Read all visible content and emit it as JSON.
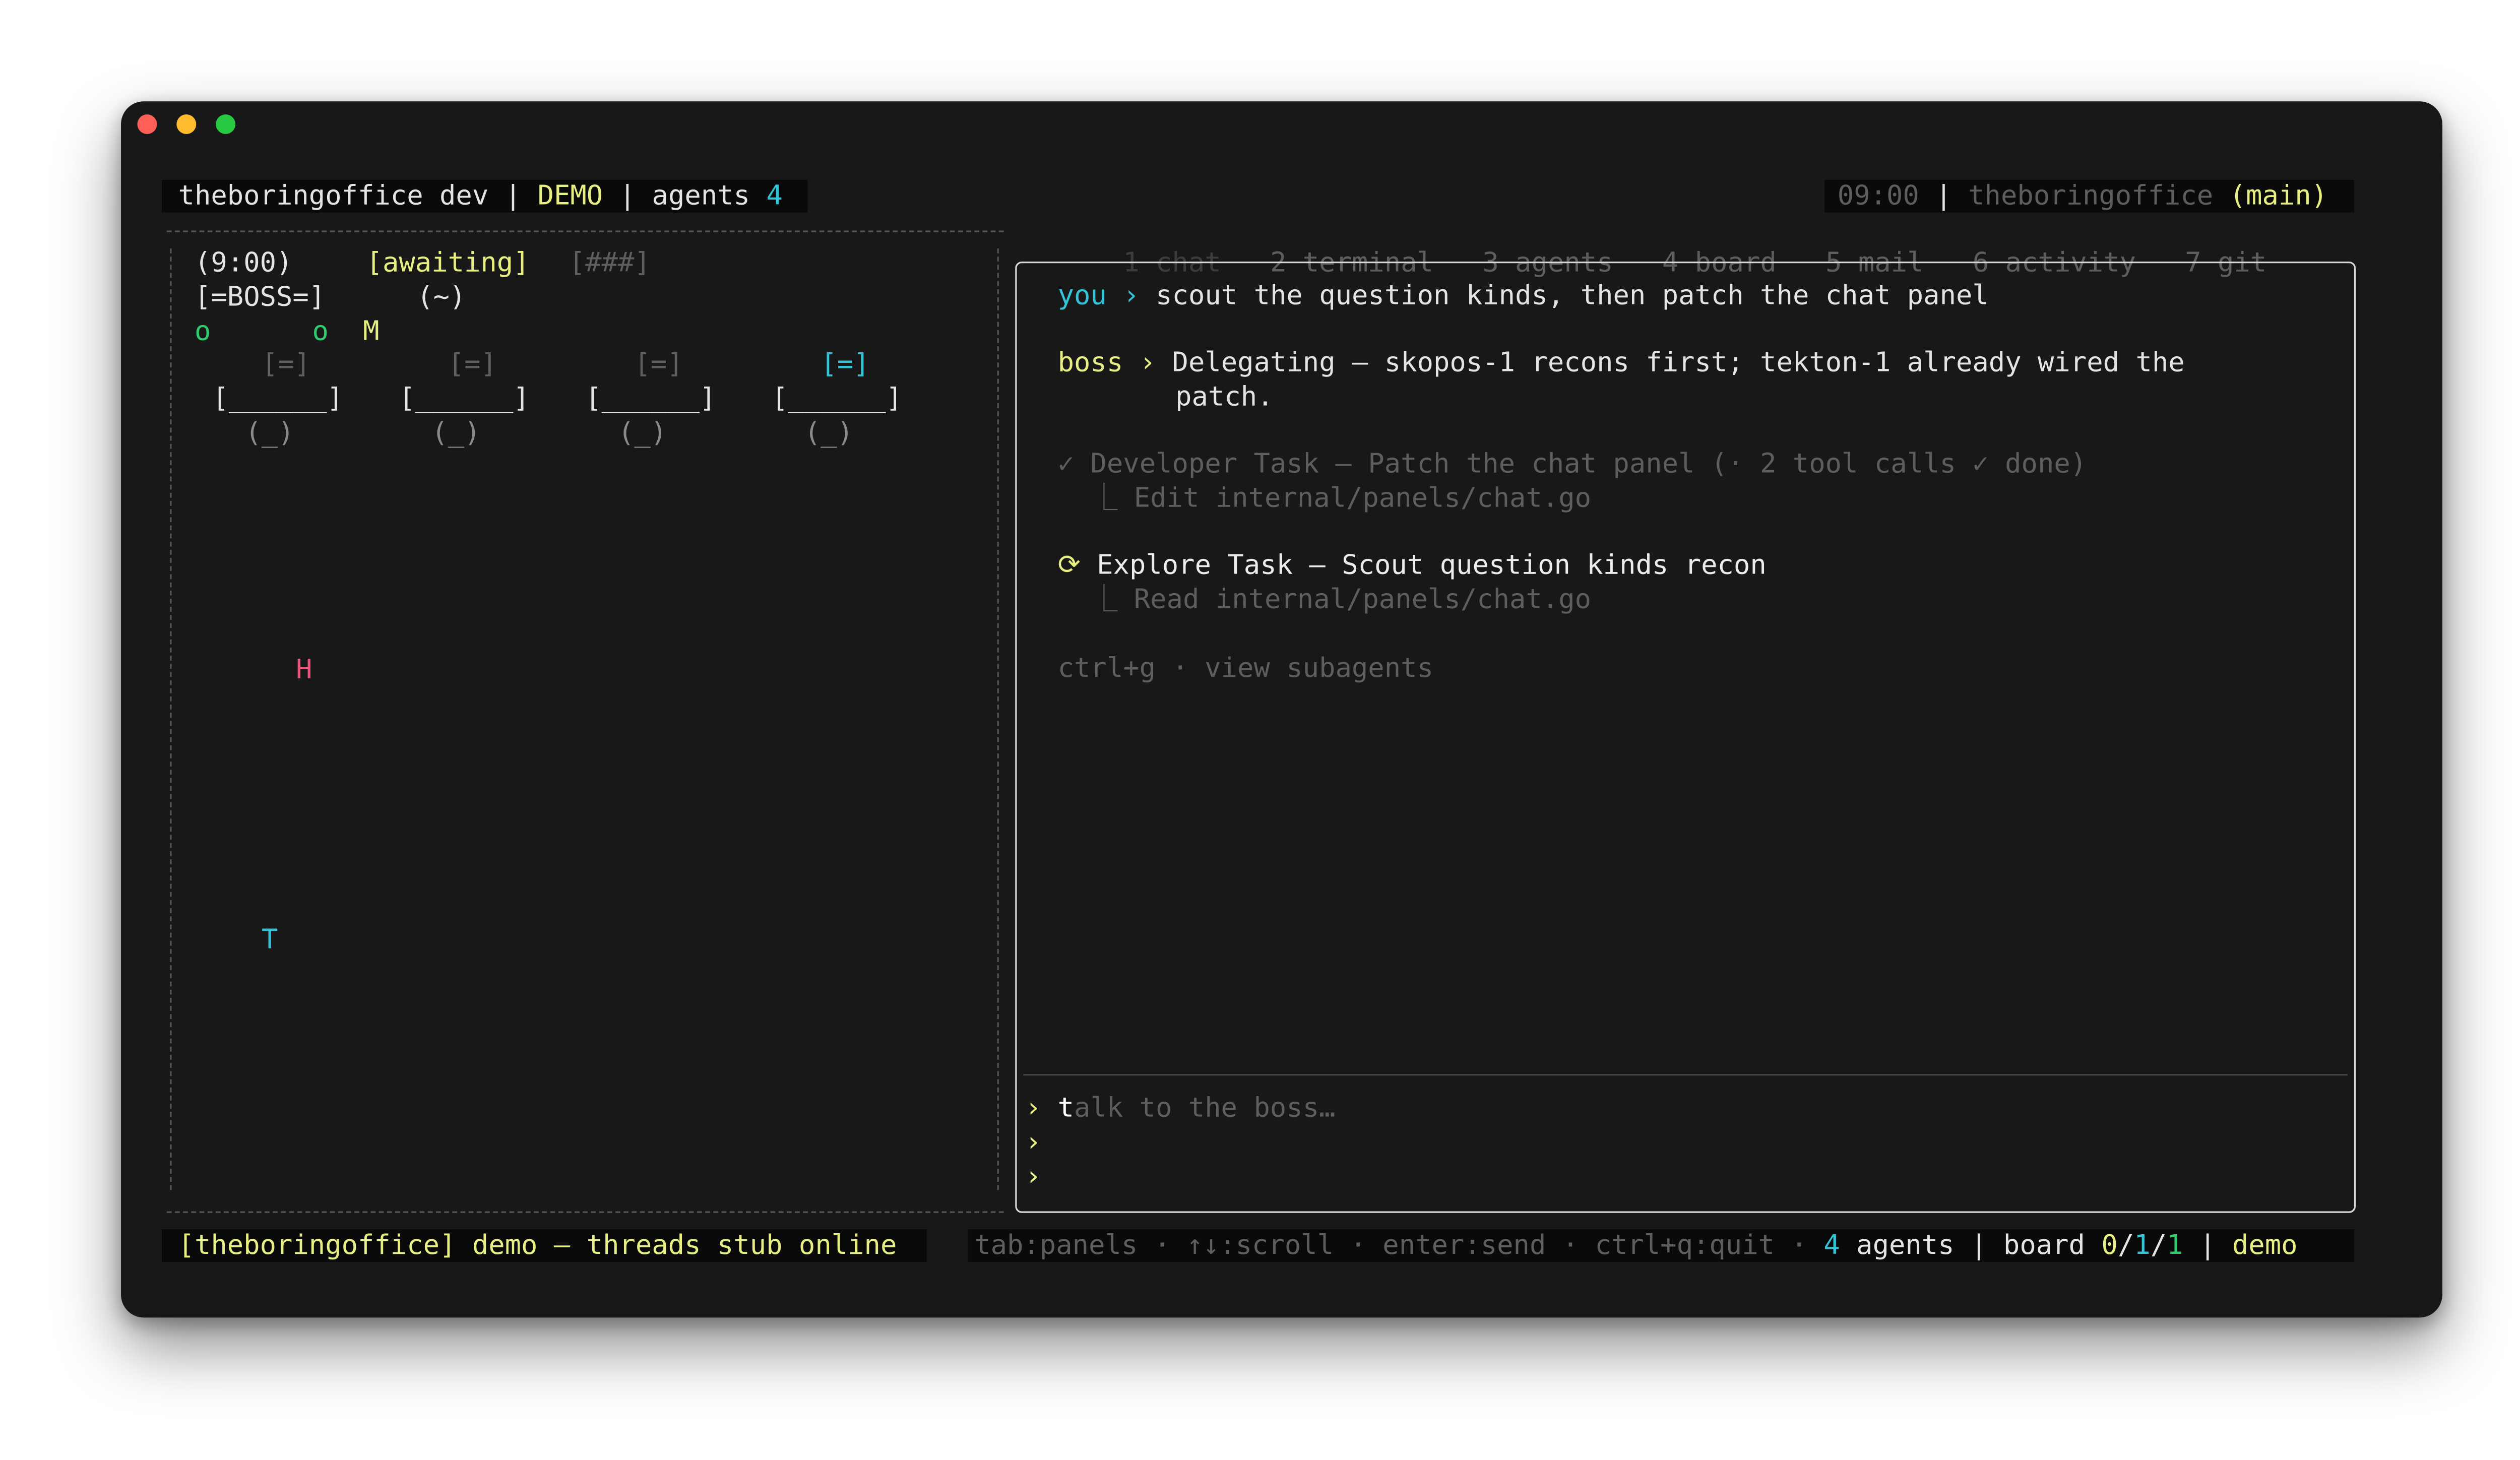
{
  "window": {
    "traffic_lights": {
      "close": "#fe5f57",
      "minimize": "#febc2e",
      "zoom": "#28c840"
    }
  },
  "header": {
    "title": "theboringoffice dev",
    "sep1": "|",
    "mode": "DEMO",
    "sep2": "|",
    "agents_label": "agents",
    "agents_count": "4",
    "clock": "09:00",
    "sep3": "|",
    "repo": "theboringoffice",
    "branch": "(main)"
  },
  "tabs": [
    {
      "label": "1 chat",
      "active": true
    },
    {
      "label": "2 terminal"
    },
    {
      "label": "3 agents"
    },
    {
      "label": "4 board"
    },
    {
      "label": "5 mail"
    },
    {
      "label": "6 activity"
    },
    {
      "label": "7 git"
    }
  ],
  "office": {
    "time": "(9:00)",
    "status": "[awaiting]",
    "progress": "[###]",
    "boss_label": "[=BOSS=]",
    "boss_face": "(~)",
    "agents_row": [
      "o",
      "o",
      "M"
    ],
    "monitors": [
      "[=]",
      "[=]",
      "[=]",
      "[=]"
    ],
    "desks": [
      "[______]",
      "[______]",
      "[______]",
      "[______]"
    ],
    "chairs": [
      "(_)",
      "(_)",
      "(_)",
      "(_)"
    ],
    "walker_h": "H",
    "walker_t": "T"
  },
  "chat": {
    "messages": [
      {
        "speaker": "you",
        "arrow": "›",
        "text": "scout the question kinds, then patch the chat panel"
      },
      {
        "speaker": "boss",
        "arrow": "›",
        "text_line1": "Delegating — skopos-1 recons first; tekton-1 already wired the",
        "text_line2": "patch."
      }
    ],
    "tasks": [
      {
        "marker": "✓",
        "title": "Developer Task — Patch the chat panel (· 2 tool calls ✓ done)",
        "sub_marker": "⎿",
        "sub": "Edit internal/panels/chat.go"
      },
      {
        "marker": "⟳",
        "title": "Explore Task — Scout question kinds recon",
        "sub_marker": "⎿",
        "sub": "Read internal/panels/chat.go"
      }
    ],
    "hint": "ctrl+g · view subagents",
    "prompt": "›",
    "cursor_char": "t",
    "placeholder": "alk to the boss…"
  },
  "footer": {
    "status": "[theboringoffice] demo — threads stub online",
    "keys": "tab:panels · ↑↓:scroll · enter:send · ctrl+q:quit ·",
    "agents_count": "4",
    "agents_label": "agents",
    "sep1": "|",
    "board_label": "board",
    "board_a": "0",
    "board_slash1": "/",
    "board_b": "1",
    "board_slash2": "/",
    "board_c": "1",
    "sep2": "|",
    "mode": "demo"
  }
}
